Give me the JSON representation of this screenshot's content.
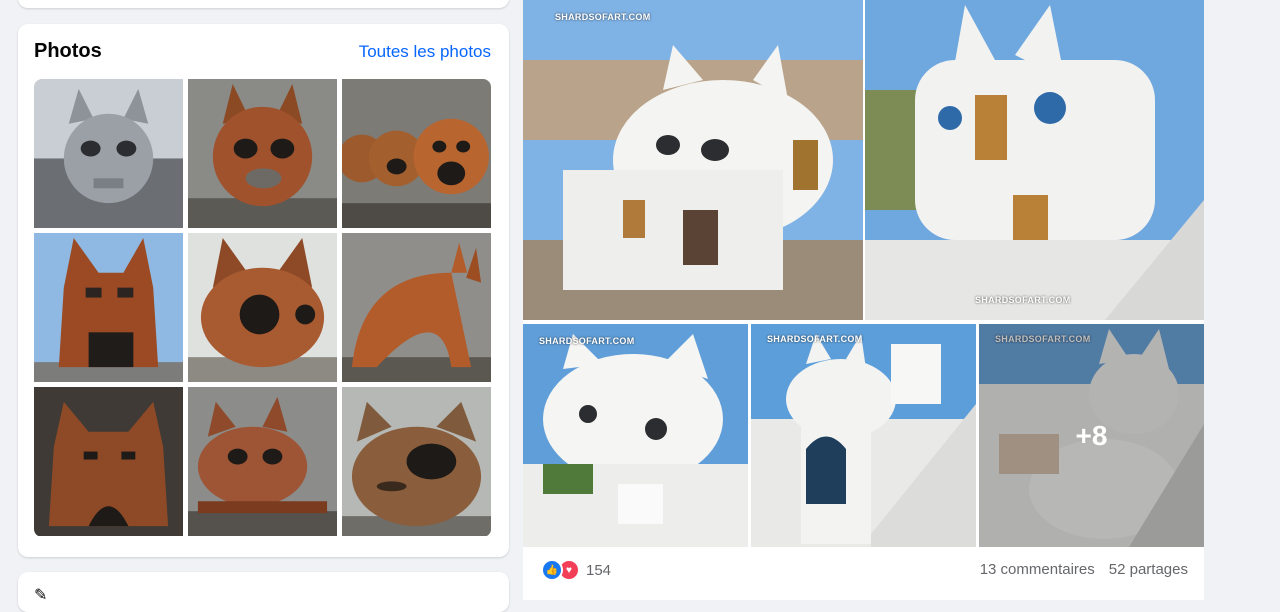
{
  "photos_card": {
    "title": "Photos",
    "see_all_label": "Toutes les photos",
    "thumbnails": [
      {
        "icon": "metal-cat-sculpture",
        "color": "#9aa0a6"
      },
      {
        "icon": "rusty-cat-sphere",
        "color": "#a0522d"
      },
      {
        "icon": "rusty-cat-tanks",
        "color": "#b8652f"
      },
      {
        "icon": "rusty-cat-building",
        "color": "#9c4a24"
      },
      {
        "icon": "rusty-cat-dome",
        "color": "#a85a30"
      },
      {
        "icon": "rusty-cat-arch",
        "color": "#b35c2b"
      },
      {
        "icon": "rusty-cat-structure",
        "color": "#8e4a26"
      },
      {
        "icon": "rusty-cat-vehicle",
        "color": "#9e5536"
      },
      {
        "icon": "rusty-cat-pod",
        "color": "#7f5a3c"
      }
    ]
  },
  "post": {
    "watermark": "SHARDSOFART.COM",
    "more_count": "+8",
    "reaction_count": "154",
    "comments_label": "13 commentaires",
    "shares_label": "52 partages",
    "images": [
      {
        "icon": "white-cat-house-santorini",
        "color": "#f4f4f2"
      },
      {
        "icon": "white-cat-house-santorini",
        "color": "#f2f2f0"
      },
      {
        "icon": "white-cat-house",
        "color": "#f5f5f3"
      },
      {
        "icon": "white-cat-stairs",
        "color": "#f3f3f1"
      },
      {
        "icon": "white-cat-villa",
        "color": "#efefee"
      }
    ]
  },
  "colors": {
    "link": "#0866ff",
    "like": "#1877f2",
    "love": "#f33e58",
    "sky": "#5b9bd5",
    "rust": "#a0522d"
  }
}
